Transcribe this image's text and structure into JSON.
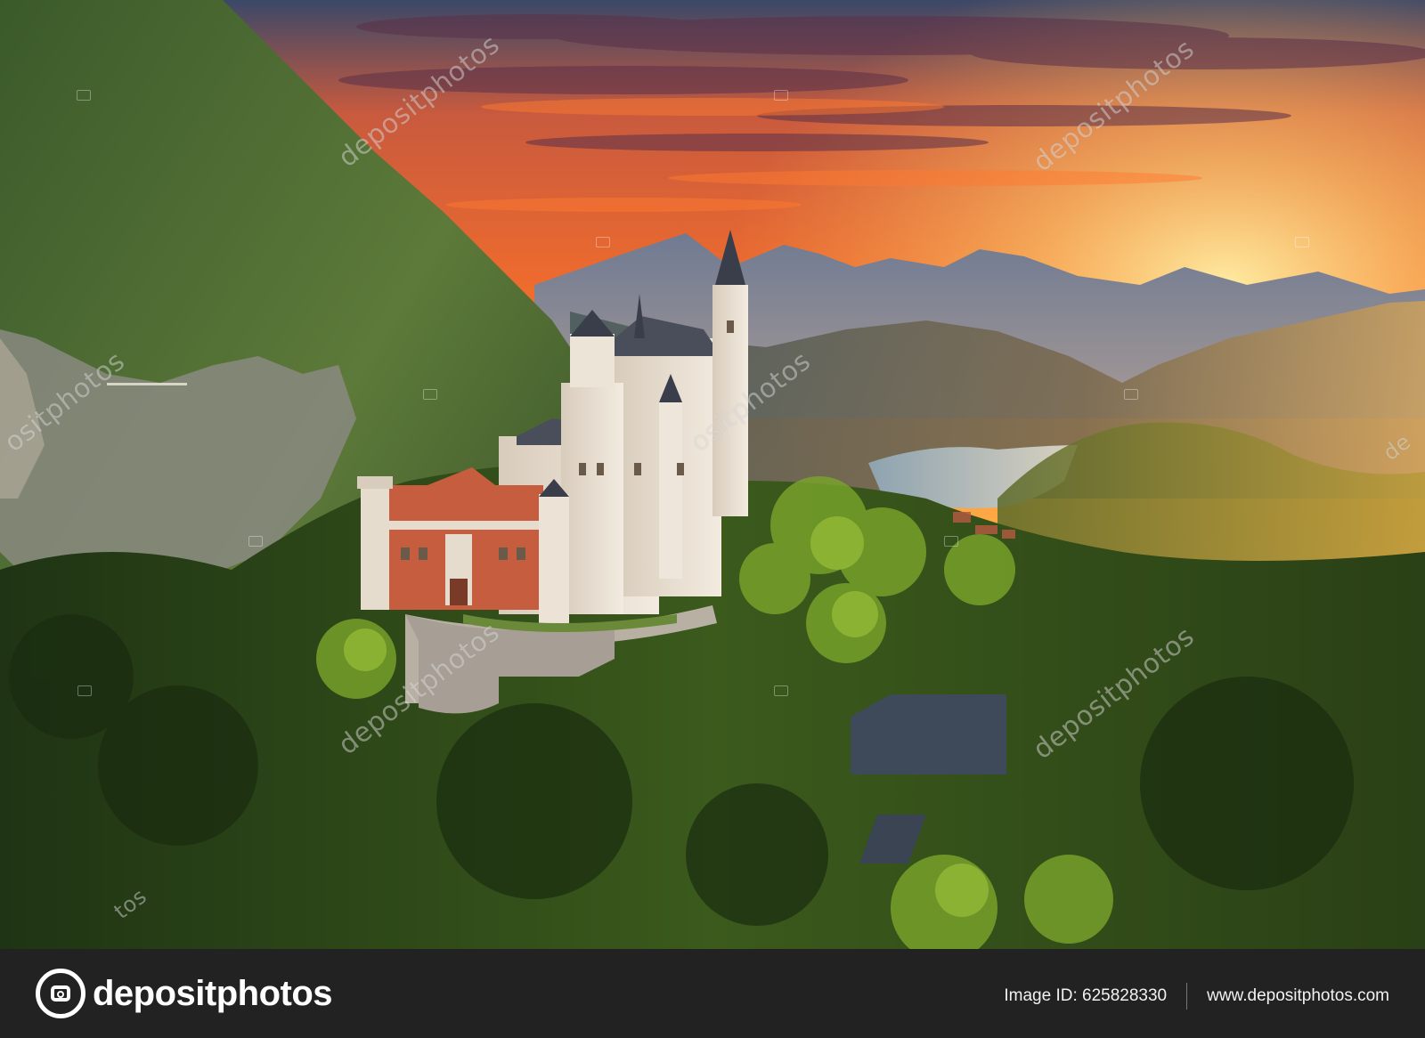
{
  "photo": {
    "subject": "castle-on-forested-hill-at-sunset",
    "colors": {
      "sky_top": "#3a4a6a",
      "sky_orange": "#f06a2a",
      "sky_glow": "#ffc24a",
      "mountains_far": "#7a7e90",
      "forest": "#2f4a1c",
      "forest_light": "#8ab030",
      "castle_wall": "#e8ddd0",
      "castle_brick": "#c0583a",
      "lake": "#b9c4cc"
    }
  },
  "watermark": {
    "text": "depositphotos",
    "text_short": "ositphotos",
    "text_tail": "tos",
    "text_edge": "de"
  },
  "footer": {
    "brand_name": "depositphotos",
    "brand_icon": "camera-icon",
    "image_id_label": "Image ID: 625828330",
    "site_url": "www.depositphotos.com"
  }
}
